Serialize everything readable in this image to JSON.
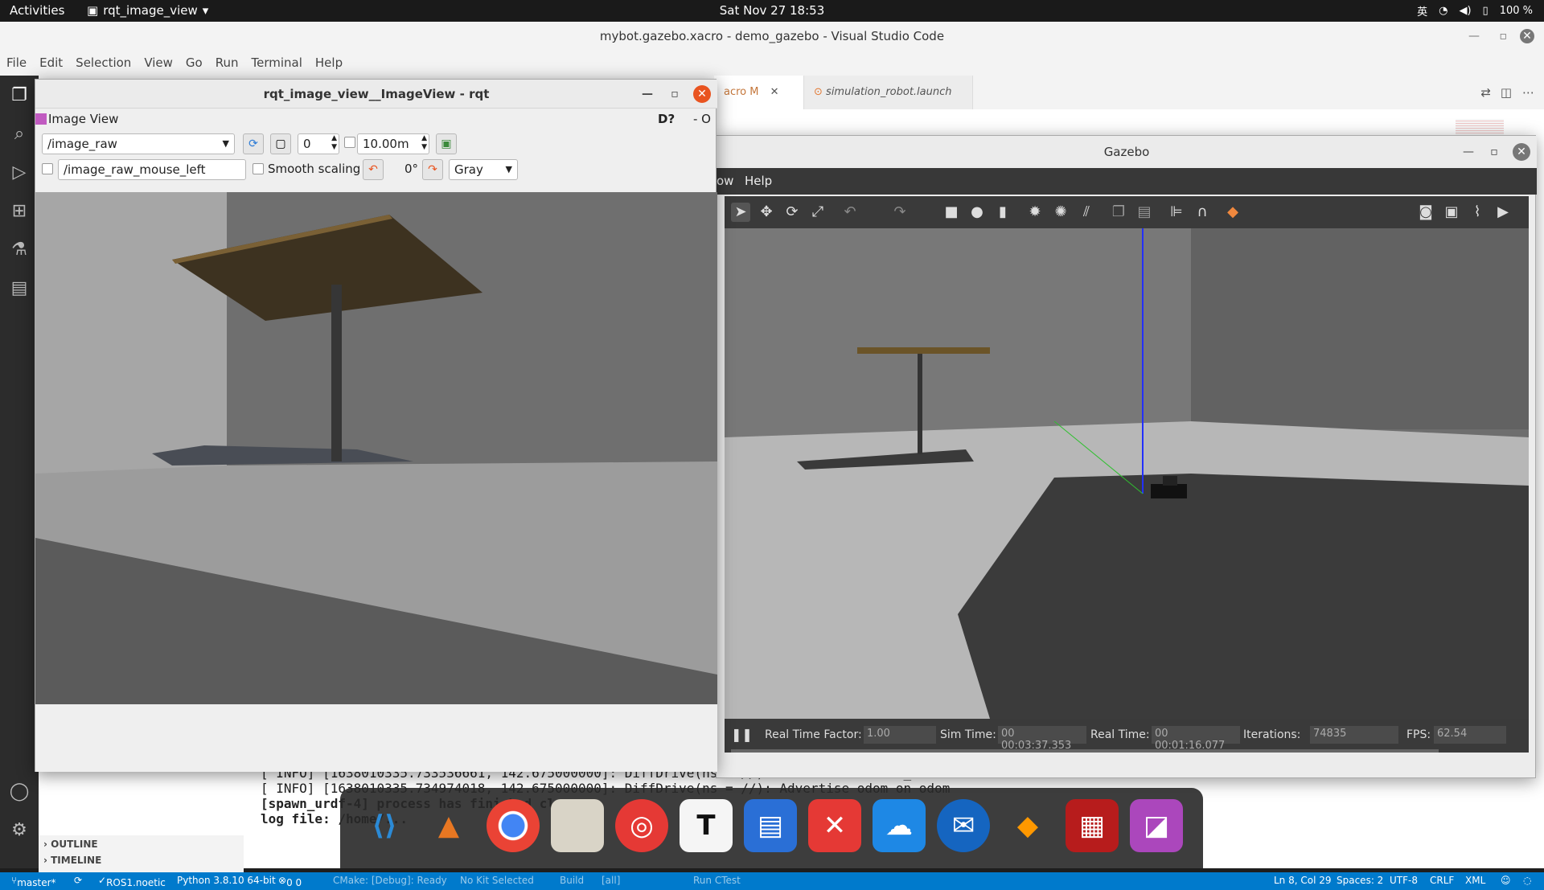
{
  "topbar": {
    "activities": "Activities",
    "app_menu": "rqt_image_view",
    "clock": "Sat Nov 27  18:53",
    "input_method": "英",
    "battery": "100 %"
  },
  "vscode": {
    "title": "mybot.gazebo.xacro - demo_gazebo - Visual Studio Code",
    "menu": [
      "File",
      "Edit",
      "Selection",
      "View",
      "Go",
      "Run",
      "Terminal",
      "Help"
    ],
    "tabs": [
      {
        "label": "acro M",
        "active": true
      },
      {
        "label": "simulation_robot.launch",
        "active": false
      }
    ],
    "sidebar_sections": [
      "OUTLINE",
      "TIMELINE"
    ],
    "terminal_lines": [
      "[ INFO] [1638010335.733536661, 142.675000000]: DiffDrive(ns = //): Subscribe to cmd_vel",
      "[ INFO] [1638010335.734974018, 142.675000000]: DiffDrive(ns = //): Advertise odom on odom",
      "[spawn_urdf-4] process has finished clean",
      "log file: /home/..."
    ],
    "status": {
      "branch": "master*",
      "ros": "ROS1.noetic",
      "python": "Python 3.8.10 64-bit",
      "problems": "0  0",
      "cmake": "CMake: [Debug]: Ready",
      "kit": "No Kit Selected",
      "build": "Build",
      "all": "[all]",
      "ctest": "Run CTest",
      "position": "Ln 8, Col 29",
      "spaces": "Spaces: 2",
      "encoding": "UTF-8",
      "eol": "CRLF",
      "language": "XML"
    }
  },
  "rqt": {
    "title": "rqt_image_view__ImageView - rqt",
    "plugin_title": "Image View",
    "plugin_help": "D?",
    "plugin_extra": "- O",
    "topic": "/image_raw",
    "spin_value": "0",
    "max_range": "10.00m",
    "mouse_topic": "/image_raw_mouse_left",
    "smooth_scaling_label": "Smooth scaling",
    "rotation": "0°",
    "colormap": "Gray"
  },
  "gazebo": {
    "title": "Gazebo",
    "menu": [
      "ow",
      "Help"
    ],
    "bottom": {
      "rtf_label": "Real Time Factor:",
      "rtf_value": "1.00",
      "sim_label": "Sim Time:",
      "sim_value": "00 00:03:37.353",
      "real_label": "Real Time:",
      "real_value": "00 00:01:16.077",
      "iter_label": "Iterations:",
      "iter_value": "74835",
      "fps_label": "FPS:",
      "fps_value": "62.54"
    }
  },
  "dock": {
    "apps": [
      "vscode-icon",
      "matlab-icon",
      "chrome-icon",
      "files-icon",
      "netease-music-icon",
      "typora-icon",
      "writer-icon",
      "xmind-icon",
      "cloud-icon",
      "thunderbird-icon",
      "sublime-icon",
      "screen-recorder-icon",
      "image-viewer-icon"
    ]
  },
  "colors": {
    "vscode_status": "#007acc",
    "ubuntu_orange": "#e95420",
    "gazebo_dark": "#3a3a3a"
  }
}
